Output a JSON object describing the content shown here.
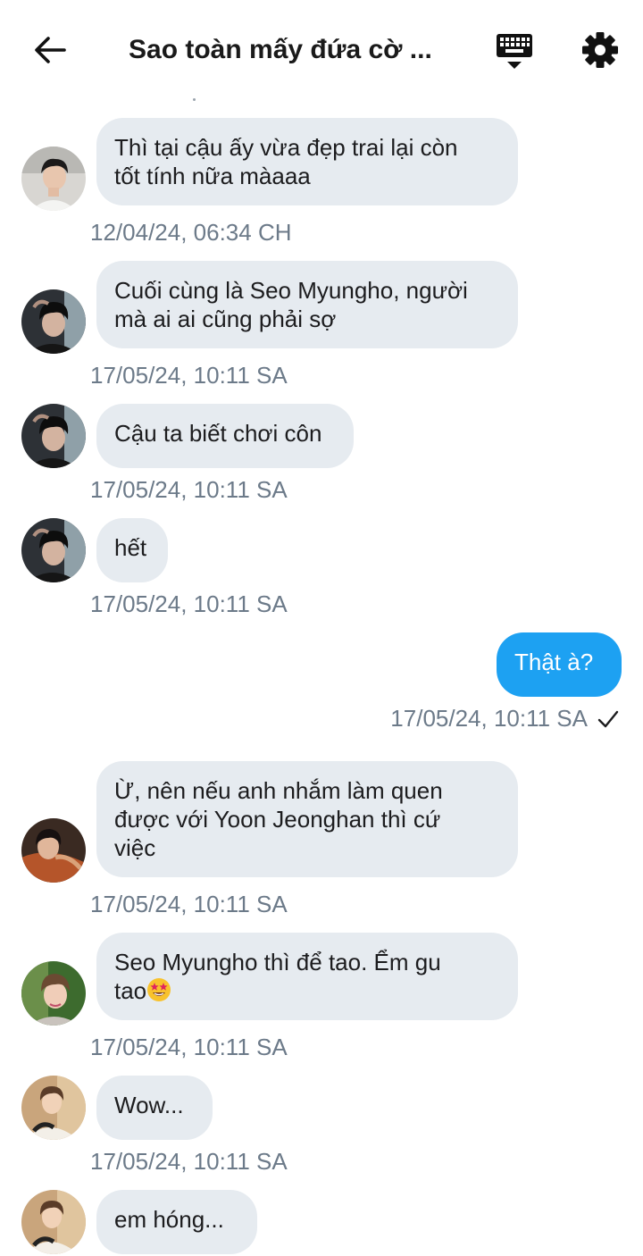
{
  "header": {
    "title": "Sao toàn mấy đứa cờ ...",
    "back_icon": "arrow-left-icon",
    "keyboard_icon": "keyboard-hide-icon",
    "settings_icon": "gear-icon"
  },
  "colors": {
    "incoming_bubble": "#e6ebf0",
    "outgoing_bubble": "#1da1f2",
    "timestamp": "#6c7a89"
  },
  "messages": [
    {
      "direction": "incoming",
      "text": "Thì tại cậu ấy vừa đẹp trai lại còn\ntốt tính nữa màaaa",
      "time": "12/04/24, 06:34 CH",
      "avatar": "avatar-boy-white-shirt"
    },
    {
      "direction": "incoming",
      "text": "Cuối cùng là Seo Myungho, người\nmà ai ai cũng phải sợ",
      "time": "17/05/24, 10:11 SA",
      "avatar": "avatar-boy-dark-hair"
    },
    {
      "direction": "incoming",
      "text": "Cậu ta biết chơi côn",
      "time": "17/05/24, 10:11 SA",
      "avatar": "avatar-boy-dark-hair"
    },
    {
      "direction": "incoming",
      "text": "hết",
      "time": "17/05/24, 10:11 SA",
      "avatar": "avatar-boy-dark-hair"
    },
    {
      "direction": "outgoing",
      "text": "Thật à?",
      "time": "17/05/24, 10:11 SA",
      "status_icon": "checkmark-icon"
    },
    {
      "direction": "incoming",
      "text": "Ừ, nên nếu anh nhắm làm quen\nđược với Yoon Jeonghan thì cứ\nviệc",
      "time": "17/05/24, 10:11 SA",
      "avatar": "avatar-boy-brown-jacket"
    },
    {
      "direction": "incoming",
      "text": "Seo Myungho thì để tao. Ểm gu\ntao",
      "emoji": "star-struck-emoji",
      "time": "17/05/24, 10:11 SA",
      "avatar": "avatar-boy-green"
    },
    {
      "direction": "incoming",
      "text": "Wow...",
      "time": "17/05/24, 10:11 SA",
      "avatar": "avatar-boy-seated"
    },
    {
      "direction": "incoming",
      "text": "em hóng...",
      "time": "",
      "avatar": "avatar-boy-seated"
    }
  ]
}
